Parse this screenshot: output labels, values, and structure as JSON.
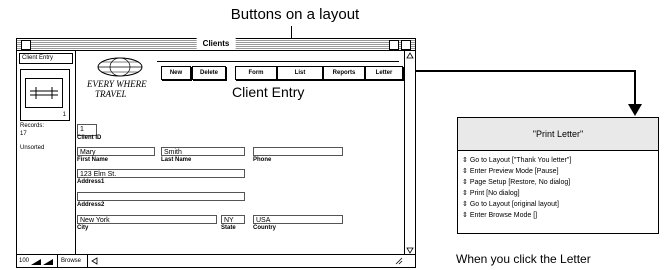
{
  "callout": {
    "title": "Buttons on a layout"
  },
  "window": {
    "title": "Clients",
    "status": {
      "layout_popup": "Client Entry",
      "records_label": "Records:",
      "records_count": "17",
      "sort_state": "Unsorted",
      "book_page": "1",
      "zoom_level": "100",
      "mode": "Browse"
    },
    "header": {
      "logo_line1": "Every Where",
      "logo_line2": "Travel",
      "title": "Client Entry"
    },
    "buttons": [
      {
        "label": "New"
      },
      {
        "label": "Delete"
      },
      {
        "label": "Form"
      },
      {
        "label": "List"
      },
      {
        "label": "Reports"
      },
      {
        "label": "Letter"
      }
    ],
    "fields": {
      "client_id": {
        "value": "1",
        "label": "Client ID"
      },
      "first_name": {
        "value": "Mary",
        "label": "First Name"
      },
      "last_name": {
        "value": "Smith",
        "label": "Last Name"
      },
      "phone": {
        "value": "",
        "label": "Phone"
      },
      "address1": {
        "value": "123 Elm St.",
        "label": "Address1"
      },
      "address2": {
        "value": "",
        "label": "Address2"
      },
      "city": {
        "value": "New York",
        "label": "City"
      },
      "state": {
        "value": "NY",
        "label": "State"
      },
      "country": {
        "value": "USA",
        "label": "Country"
      }
    }
  },
  "script": {
    "name": "\"Print Letter\"",
    "steps": [
      "Go to Layout [\"Thank You letter\"]",
      "Enter Preview Mode [Pause]",
      "Page Setup [Restore, No dialog]",
      "Print [No dialog]",
      "Go to Layout [original layout]",
      "Enter Browse Mode []"
    ]
  },
  "caption": "When you click the Letter"
}
